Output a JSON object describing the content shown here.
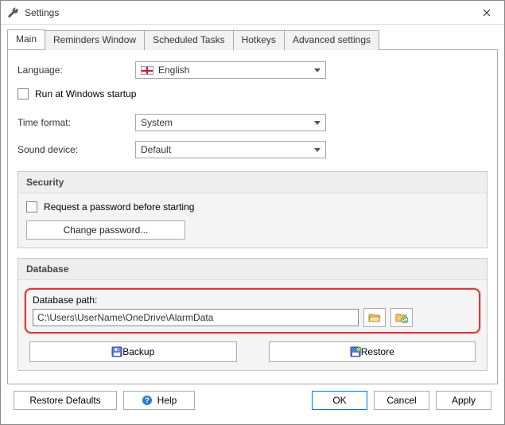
{
  "window": {
    "title": "Settings"
  },
  "tabs": {
    "main": "Main",
    "reminders": "Reminders Window",
    "scheduled": "Scheduled Tasks",
    "hotkeys": "Hotkeys",
    "advanced": "Advanced settings"
  },
  "main": {
    "language_label": "Language:",
    "language_value": "English",
    "run_startup": "Run at Windows startup",
    "time_format_label": "Time format:",
    "time_format_value": "System",
    "sound_device_label": "Sound device:",
    "sound_device_value": "Default"
  },
  "security": {
    "legend": "Security",
    "request_password": "Request a password before starting",
    "change_password": "Change password..."
  },
  "database": {
    "legend": "Database",
    "path_label": "Database path:",
    "path_value": "C:\\Users\\UserName\\OneDrive\\AlarmData",
    "backup": "Backup",
    "restore": "Restore"
  },
  "footer": {
    "restore_defaults": "Restore Defaults",
    "help": "Help",
    "ok": "OK",
    "cancel": "Cancel",
    "apply": "Apply"
  }
}
